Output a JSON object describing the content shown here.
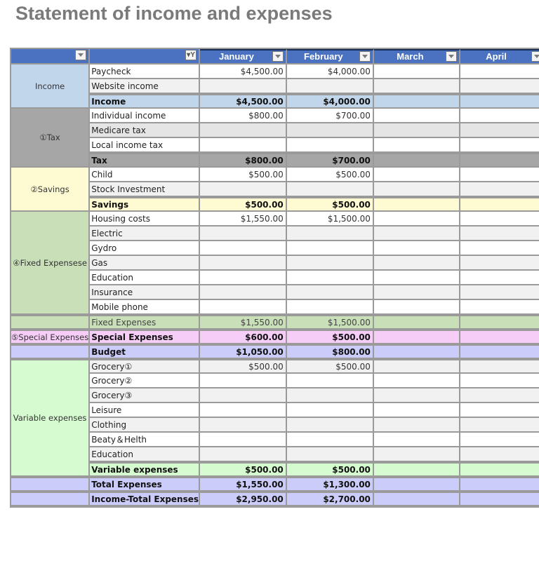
{
  "title": "Statement of income and expenses",
  "header": {
    "columns": [
      {
        "label": "",
        "filter_icon": "dropdown-arrow-icon"
      },
      {
        "label": "",
        "filter_icon": "filter-active-icon"
      },
      {
        "label": "January",
        "filter_icon": "dropdown-arrow-icon"
      },
      {
        "label": "February",
        "filter_icon": "dropdown-arrow-icon"
      },
      {
        "label": "March",
        "filter_icon": "dropdown-arrow-icon"
      },
      {
        "label": "April",
        "filter_icon": "dropdown-arrow-icon"
      }
    ]
  },
  "colors": {
    "header": "#4a72c0",
    "income": "#c2d6eb",
    "tax": "#a6a6a6",
    "savings": "#fefad2",
    "fixed": "#c8dfb8",
    "special": "#f6cdf7",
    "budget": "#ccccfa",
    "variable": "#d6fbd0",
    "title": "#7a7a7a"
  },
  "groups": {
    "income": "Income",
    "tax": "①Tax",
    "savings": "②Savings",
    "fixed": "④Fixed Expensese",
    "special": "⑤Special Expenses",
    "variable": "Variable expenses"
  },
  "rows": [
    {
      "item": "Paycheck",
      "values": [
        "$4,500.00",
        "$4,000.00",
        "",
        ""
      ]
    },
    {
      "item": "Website income",
      "values": [
        "",
        "",
        "",
        ""
      ]
    },
    {
      "item": "Income",
      "values": [
        "$4,500.00",
        "$4,000.00",
        "",
        ""
      ]
    },
    {
      "item": "Individual income",
      "values": [
        "$800.00",
        "$700.00",
        "",
        ""
      ]
    },
    {
      "item": "Medicare tax",
      "values": [
        "",
        "",
        "",
        ""
      ]
    },
    {
      "item": "Local income tax",
      "values": [
        "",
        "",
        "",
        ""
      ]
    },
    {
      "item": "Tax",
      "values": [
        "$800.00",
        "$700.00",
        "",
        ""
      ]
    },
    {
      "item": "Child",
      "values": [
        "$500.00",
        "$500.00",
        "",
        ""
      ]
    },
    {
      "item": "Stock Investment",
      "values": [
        "",
        "",
        "",
        ""
      ]
    },
    {
      "item": "Savings",
      "values": [
        "$500.00",
        "$500.00",
        "",
        ""
      ]
    },
    {
      "item": "Housing costs",
      "values": [
        "$1,550.00",
        "$1,500.00",
        "",
        ""
      ]
    },
    {
      "item": "Electric",
      "values": [
        "",
        "",
        "",
        ""
      ]
    },
    {
      "item": "Gydro",
      "values": [
        "",
        "",
        "",
        ""
      ]
    },
    {
      "item": "Gas",
      "values": [
        "",
        "",
        "",
        ""
      ]
    },
    {
      "item": "Education",
      "values": [
        "",
        "",
        "",
        ""
      ]
    },
    {
      "item": "Insurance",
      "values": [
        "",
        "",
        "",
        ""
      ]
    },
    {
      "item": "Mobile phone",
      "values": [
        "",
        "",
        "",
        ""
      ]
    },
    {
      "item": "Fixed Expenses",
      "values": [
        "$1,550.00",
        "$1,500.00",
        "",
        ""
      ]
    },
    {
      "item": "Special Expenses",
      "values": [
        "$600.00",
        "$500.00",
        "",
        ""
      ]
    },
    {
      "item": "Budget",
      "values": [
        "$1,050.00",
        "$800.00",
        "",
        ""
      ]
    },
    {
      "item": "Grocery①",
      "values": [
        "$500.00",
        "$500.00",
        "",
        ""
      ]
    },
    {
      "item": "Grocery②",
      "values": [
        "",
        "",
        "",
        ""
      ]
    },
    {
      "item": "Grocery③",
      "values": [
        "",
        "",
        "",
        ""
      ]
    },
    {
      "item": "Leisure",
      "values": [
        "",
        "",
        "",
        ""
      ]
    },
    {
      "item": "Clothing",
      "values": [
        "",
        "",
        "",
        ""
      ]
    },
    {
      "item": "Beaty＆Helth",
      "values": [
        "",
        "",
        "",
        ""
      ]
    },
    {
      "item": "Education",
      "values": [
        "",
        "",
        "",
        ""
      ]
    },
    {
      "item": "Variable expenses",
      "values": [
        "$500.00",
        "$500.00",
        "",
        ""
      ]
    },
    {
      "item": "Total Expenses",
      "values": [
        "$1,550.00",
        "$1,300.00",
        "",
        ""
      ]
    },
    {
      "item": "Income-Total Expenses",
      "values": [
        "$2,950.00",
        "$2,700.00",
        "",
        ""
      ]
    }
  ]
}
